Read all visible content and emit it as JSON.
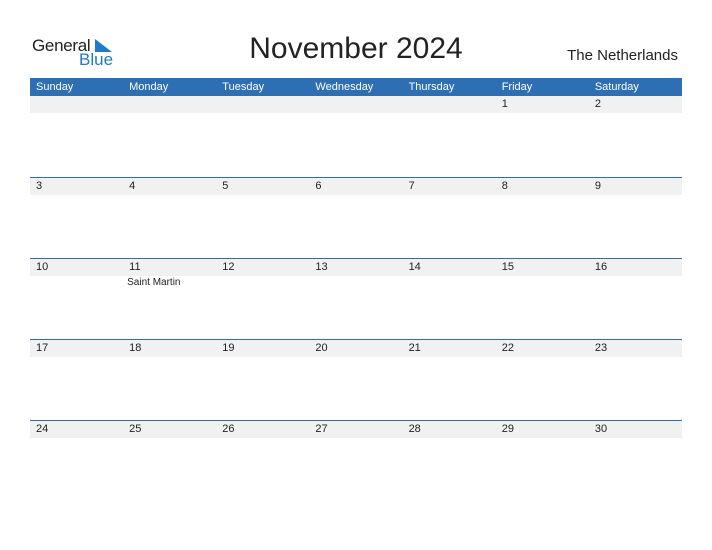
{
  "logo": {
    "general": "General",
    "blue": "Blue"
  },
  "title": "November 2024",
  "country": "The Netherlands",
  "days": [
    "Sunday",
    "Monday",
    "Tuesday",
    "Wednesday",
    "Thursday",
    "Friday",
    "Saturday"
  ],
  "weeks": [
    {
      "dates": [
        "",
        "",
        "",
        "",
        "",
        "1",
        "2"
      ],
      "events": [
        "",
        "",
        "",
        "",
        "",
        "",
        ""
      ]
    },
    {
      "dates": [
        "3",
        "4",
        "5",
        "6",
        "7",
        "8",
        "9"
      ],
      "events": [
        "",
        "",
        "",
        "",
        "",
        "",
        ""
      ]
    },
    {
      "dates": [
        "10",
        "11",
        "12",
        "13",
        "14",
        "15",
        "16"
      ],
      "events": [
        "",
        "Saint Martin",
        "",
        "",
        "",
        "",
        ""
      ]
    },
    {
      "dates": [
        "17",
        "18",
        "19",
        "20",
        "21",
        "22",
        "23"
      ],
      "events": [
        "",
        "",
        "",
        "",
        "",
        "",
        ""
      ]
    },
    {
      "dates": [
        "24",
        "25",
        "26",
        "27",
        "28",
        "29",
        "30"
      ],
      "events": [
        "",
        "",
        "",
        "",
        "",
        "",
        ""
      ]
    }
  ]
}
